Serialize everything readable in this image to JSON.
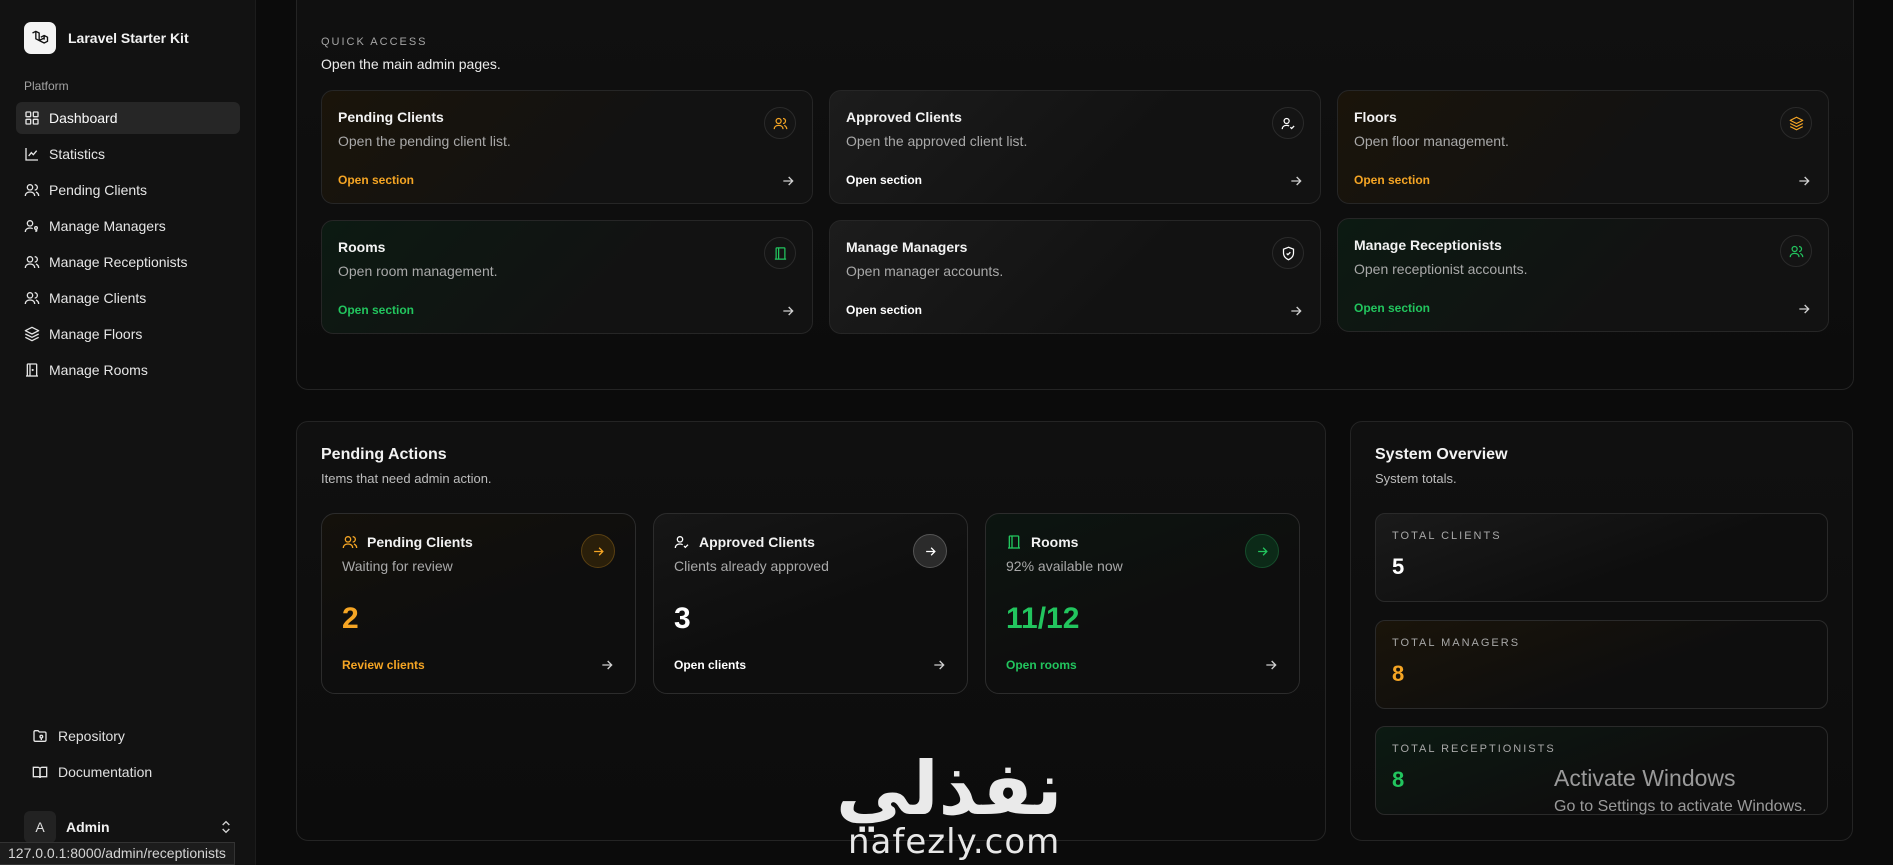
{
  "sidebar": {
    "brand": "Laravel Starter Kit",
    "group_label": "Platform",
    "items": [
      {
        "label": "Dashboard",
        "icon": "dashboard-icon",
        "active": true
      },
      {
        "label": "Statistics",
        "icon": "chart-icon"
      },
      {
        "label": "Pending Clients",
        "icon": "users-icon"
      },
      {
        "label": "Manage Managers",
        "icon": "user-key-icon"
      },
      {
        "label": "Manage Receptionists",
        "icon": "users-icon"
      },
      {
        "label": "Manage Clients",
        "icon": "users-icon"
      },
      {
        "label": "Manage Floors",
        "icon": "layers-icon"
      },
      {
        "label": "Manage Rooms",
        "icon": "door-icon"
      }
    ],
    "bottom": [
      {
        "label": "Repository",
        "icon": "folder-git-icon"
      },
      {
        "label": "Documentation",
        "icon": "book-icon"
      }
    ],
    "user": {
      "initial": "A",
      "name": "Admin"
    }
  },
  "status_url": "127.0.0.1:8000/admin/receptionists",
  "quick_access": {
    "eyebrow": "QUICK ACCESS",
    "subtitle": "Open the main admin pages.",
    "cards": [
      {
        "title": "Pending Clients",
        "desc": "Open the pending client list.",
        "link": "Open section",
        "accent": "#f5a524",
        "icon": "users-icon"
      },
      {
        "title": "Approved Clients",
        "desc": "Open the approved client list.",
        "link": "Open section",
        "accent": "#ffffff",
        "icon": "user-check-icon"
      },
      {
        "title": "Floors",
        "desc": "Open floor management.",
        "link": "Open section",
        "accent": "#f5a524",
        "icon": "layers-icon"
      },
      {
        "title": "Rooms",
        "desc": "Open room management.",
        "link": "Open section",
        "accent": "#22c55e",
        "icon": "door-icon"
      },
      {
        "title": "Manage Managers",
        "desc": "Open manager accounts.",
        "link": "Open section",
        "accent": "#ffffff",
        "icon": "shield-icon"
      },
      {
        "title": "Manage Receptionists",
        "desc": "Open receptionist accounts.",
        "link": "Open section",
        "accent": "#22c55e",
        "icon": "users-icon"
      }
    ]
  },
  "pending_actions": {
    "title": "Pending Actions",
    "subtitle": "Items that need admin action.",
    "cards": [
      {
        "title": "Pending Clients",
        "sub": "Waiting for review",
        "value": "2",
        "link": "Review clients",
        "accent": "#f5a524",
        "icon": "users-icon"
      },
      {
        "title": "Approved Clients",
        "sub": "Clients already approved",
        "value": "3",
        "link": "Open clients",
        "accent": "#ffffff",
        "icon": "user-check-icon"
      },
      {
        "title": "Rooms",
        "sub": "92% available now",
        "value": "11/12",
        "link": "Open rooms",
        "accent": "#22c55e",
        "icon": "door-icon"
      }
    ]
  },
  "system_overview": {
    "title": "System Overview",
    "subtitle": "System totals.",
    "stats": [
      {
        "label": "TOTAL CLIENTS",
        "value": "5",
        "accent": "#ffffff"
      },
      {
        "label": "TOTAL MANAGERS",
        "value": "8",
        "accent": "#f5a524"
      },
      {
        "label": "TOTAL RECEPTIONISTS",
        "value": "8",
        "accent": "#22c55e"
      }
    ]
  },
  "watermark": {
    "logo_text": "نفذلي",
    "site": "nafezly.com"
  },
  "activate_windows": {
    "line1": "Activate Windows",
    "line2": "Go to Settings to activate Windows."
  }
}
